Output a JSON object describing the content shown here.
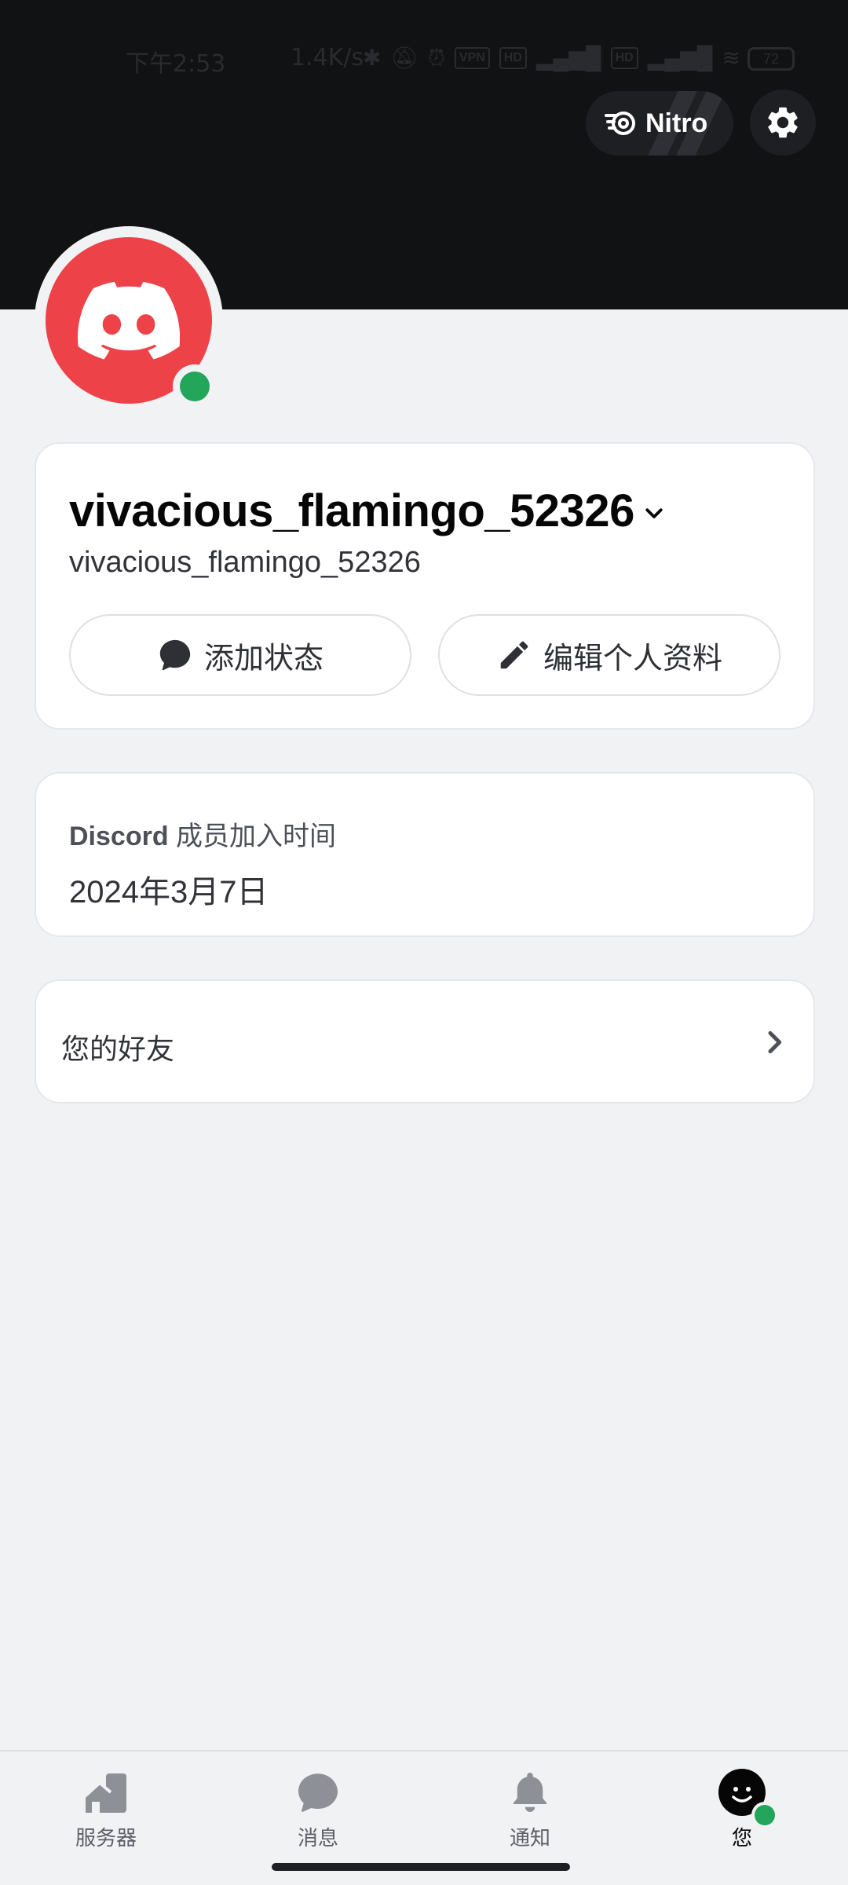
{
  "status_bar": {
    "time": "下午2:53",
    "net_rate": "1.4K/s",
    "icons": [
      "bluetooth-icon",
      "mute-icon",
      "alarm-icon",
      "vpn-icon",
      "hd-icon",
      "signal-4g-icon",
      "hd-icon",
      "signal-5g-icon",
      "wifi-icon"
    ],
    "vpn_label": "VPN",
    "hd_label": "HD",
    "battery": "72"
  },
  "header": {
    "nitro_label": "Nitro",
    "settings_icon": "gear-icon"
  },
  "profile": {
    "display_name": "vivacious_flamingo_52326",
    "username": "vivacious_flamingo_52326",
    "status": "online",
    "status_color": "#23a55a",
    "avatar_color": "#ee4249",
    "add_status_label": "添加状态",
    "edit_profile_label": "编辑个人资料"
  },
  "member_since": {
    "brand": "Discord",
    "label": "成员加入时间",
    "date": "2024年3月7日"
  },
  "friends": {
    "label": "您的好友"
  },
  "bottom_nav": {
    "items": [
      {
        "label": "服务器",
        "icon": "servers-icon",
        "active": false
      },
      {
        "label": "消息",
        "icon": "messages-icon",
        "active": false
      },
      {
        "label": "通知",
        "icon": "bell-icon",
        "active": false
      },
      {
        "label": "您",
        "icon": "you-avatar-icon",
        "active": true
      }
    ]
  },
  "colors": {
    "banner": "#111214",
    "background": "#f1f2f4",
    "card": "#ffffff",
    "brand_red": "#ee4249",
    "online_green": "#23a55a"
  }
}
